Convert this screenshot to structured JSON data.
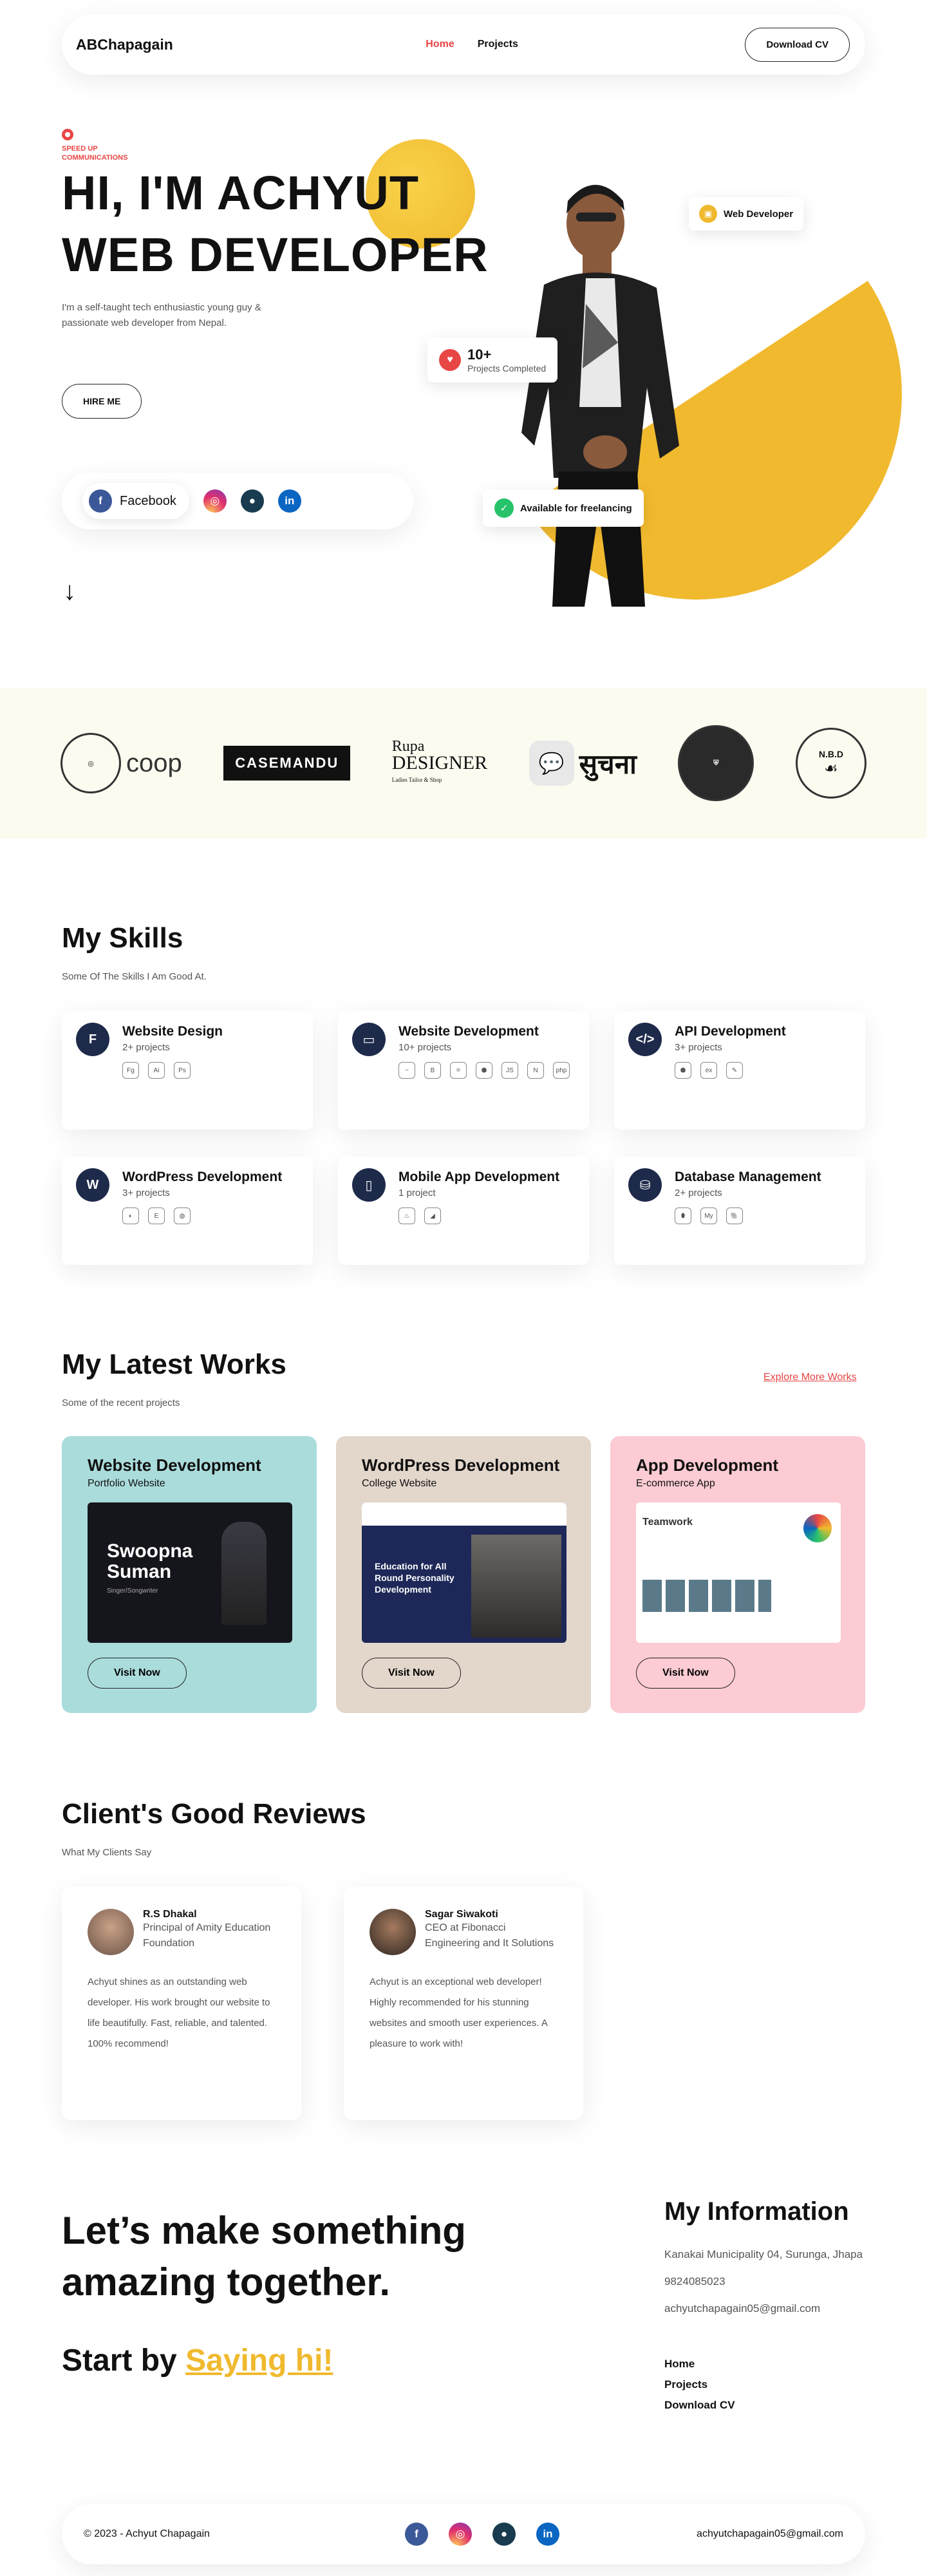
{
  "nav": {
    "logo": "ABChapagain",
    "links": [
      "Home",
      "Projects"
    ],
    "cv": "Download CV"
  },
  "hero": {
    "tag_line1": "SPEED UP",
    "tag_line2": "COMMUNICATIONS",
    "heading_line1": "HI, I'M ACHYUT",
    "heading_line2": "WEB DEVELOPER",
    "intro": "I'm a self-taught tech enthusiastic young guy & passionate web developer from Nepal.",
    "hire": "HIRE ME",
    "facebook": "Facebook",
    "chip_role": "Web Developer",
    "chip_count": "10+",
    "chip_count_label": "Projects Completed",
    "chip_status": "Available for freelancing"
  },
  "brands": {
    "coop": "coop",
    "casemandu": "CASEMANDU",
    "rupa1": "Rupa",
    "rupa2": "DESIGNER",
    "rupa3": "Ladies Tailor & Shop",
    "suchana": "सुचना",
    "nbd": "N.B.D"
  },
  "skills": {
    "title": "My Skills",
    "subtitle": "Some Of The Skills I Am Good At.",
    "items": [
      {
        "name": "Website Design",
        "count": "2+ projects",
        "icon": "figma-icon",
        "tools": [
          "Fg",
          "Ai",
          "Ps"
        ]
      },
      {
        "name": "Website Development",
        "count": "10+ projects",
        "icon": "monitor-icon",
        "tools": [
          "~",
          "B",
          "⚛",
          "⬢",
          "JS",
          "N",
          "php"
        ]
      },
      {
        "name": "API Development",
        "count": "3+ projects",
        "icon": "code-icon",
        "tools": [
          "⬢",
          "ex",
          "✎"
        ]
      },
      {
        "name": "WordPress Development",
        "count": "3+ projects",
        "icon": "wordpress-icon",
        "tools": [
          "◐",
          "E",
          "◍"
        ]
      },
      {
        "name": "Mobile App Development",
        "count": "1 project",
        "icon": "phone-icon",
        "tools": [
          "♨",
          "◢"
        ]
      },
      {
        "name": "Database Management",
        "count": "2+ projects",
        "icon": "database-icon",
        "tools": [
          "⬮",
          "My",
          "🐘"
        ]
      }
    ]
  },
  "works": {
    "title": "My Latest Works",
    "subtitle": "Some of the recent projects",
    "more": "Explore More Works",
    "items": [
      {
        "title": "Website Development",
        "sub": "Portfolio Website",
        "bg": "#abdcdc",
        "shot_title": "Swoopna Suman",
        "shot_sub": "Singer/Songwriter",
        "visit": "Visit Now"
      },
      {
        "title": "WordPress Development",
        "sub": "College Website",
        "bg": "#e3d6cb",
        "shot_title": "Education for All Round Personality Development",
        "visit": "Visit Now"
      },
      {
        "title": "App Development",
        "sub": "E-commerce App",
        "bg": "#fccbd3",
        "shot_title": "Teamwork",
        "visit": "Visit Now"
      }
    ]
  },
  "reviews": {
    "title": "Client's Good Reviews",
    "subtitle": "What My Clients Say",
    "items": [
      {
        "name": "R.S Dhakal",
        "role": "Principal of Amity Education Foundation",
        "text": "Achyut shines as an outstanding web developer. His work brought our website to life beautifully. Fast, reliable, and talented. 100% recommend!"
      },
      {
        "name": "Sagar Siwakoti",
        "role": "CEO at Fibonacci Engineering and It Solutions",
        "text": "Achyut is an exceptional web developer! Highly recommended for his stunning websites and smooth user experiences. A pleasure to work with!"
      }
    ]
  },
  "cta": {
    "line1": "Let’s make something amazing together.",
    "start": "Start by",
    "hi": "Saying hi!"
  },
  "info": {
    "title": "My Information",
    "address": "Kanakai Municipality 04, Surunga, Jhapa",
    "phone": "9824085023",
    "email": "achyutchapagain05@gmail.com",
    "links": [
      "Home",
      "Projects",
      "Download CV"
    ]
  },
  "footer": {
    "copy": "© 2023 - Achyut Chapagain",
    "email": "achyutchapagain05@gmail.com"
  },
  "colors": {
    "accent": "#f0b92e",
    "red": "#e84545",
    "navy": "#1e2a4a"
  }
}
